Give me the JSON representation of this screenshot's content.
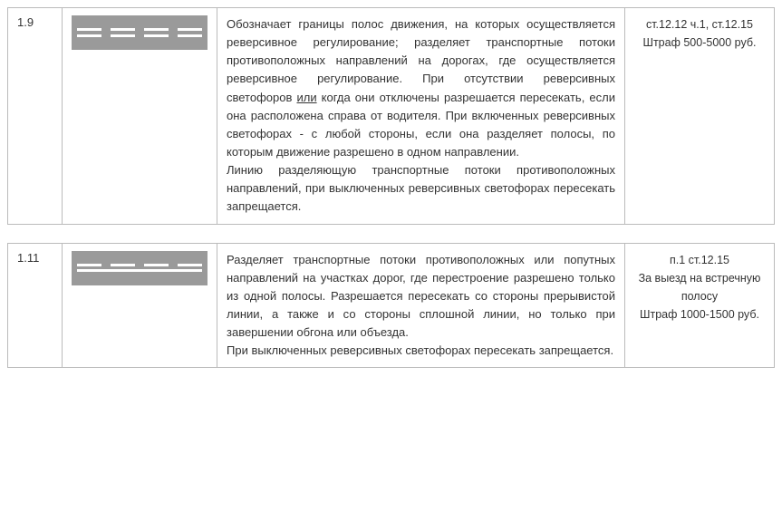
{
  "rows": [
    {
      "num": "1.9",
      "graphic": "double-dash",
      "description_html": "Обозначает границы полос движения, на которых осуществляется реверсивное регулирование; разделяет транспортные потоки противоположных направлений на дорогах, где осуществляется реверсивное регулирование. При отсутствии реверсивных светофоров <span class=\"underlined\">или</span> когда они отключены разрешается пересекать, если она расположена справа от водителя. При включенных реверсивных светофорах - с любой стороны, если она разделяет полосы, по которым движение разрешено в одном направлении.<br>Линию разделяющую транспортные потоки противоположных направлений, при выключенных реверсивных светофорах пересекать запрещается.",
      "penalty_html": "ст.12.12 ч.1, ст.12.15<br>Штраф 500-5000 руб."
    },
    {
      "num": "1.11",
      "graphic": "dash-solid",
      "description_html": "Разделяет транспортные потоки противоположных или попутных направлений на участках дорог, где перестроение разрешено только из одной полосы. Разрешается пересекать со стороны прерывистой линии, а также и со стороны сплошной линии, но только при завершении обгона или объезда.<br>При выключенных реверсивных светофорах пересекать запрещается.",
      "penalty_html": "п.1 ст.12.15<br>За выезд на встречную полосу<br>Штраф 1000-1500 руб."
    }
  ]
}
